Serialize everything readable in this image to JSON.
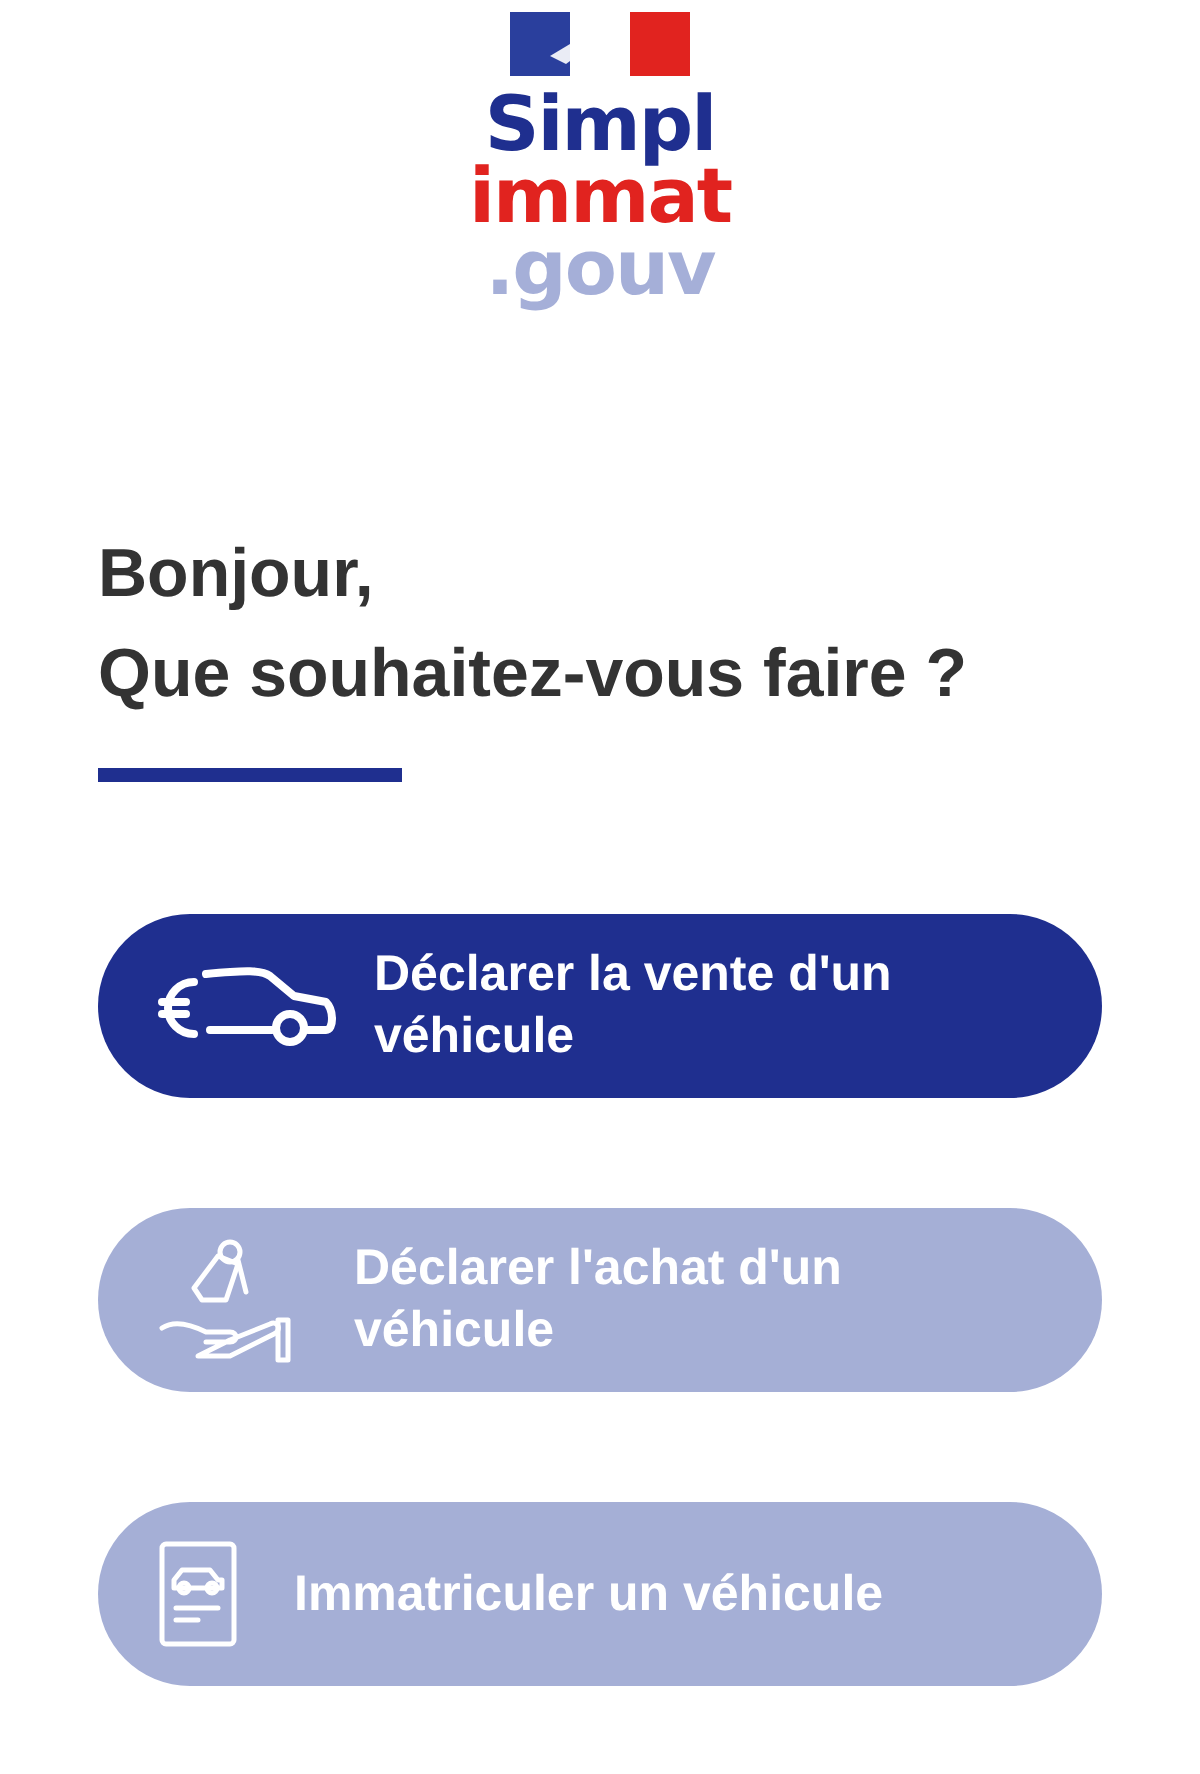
{
  "logo": {
    "line_1": "Simpl",
    "line_2": "immat",
    "line_3": ".gouv"
  },
  "heading": {
    "line_1": "Bonjour,",
    "line_2": "Que souhaitez-vous faire ?"
  },
  "actions": [
    {
      "label": "Déclarer la vente d'un véhicule",
      "kind": "sale",
      "disabled": false
    },
    {
      "label": "Déclarer l'achat d'un véhicule",
      "kind": "purchase",
      "disabled": true
    },
    {
      "label": "Immatriculer un véhicule",
      "kind": "registration",
      "disabled": true
    }
  ]
}
